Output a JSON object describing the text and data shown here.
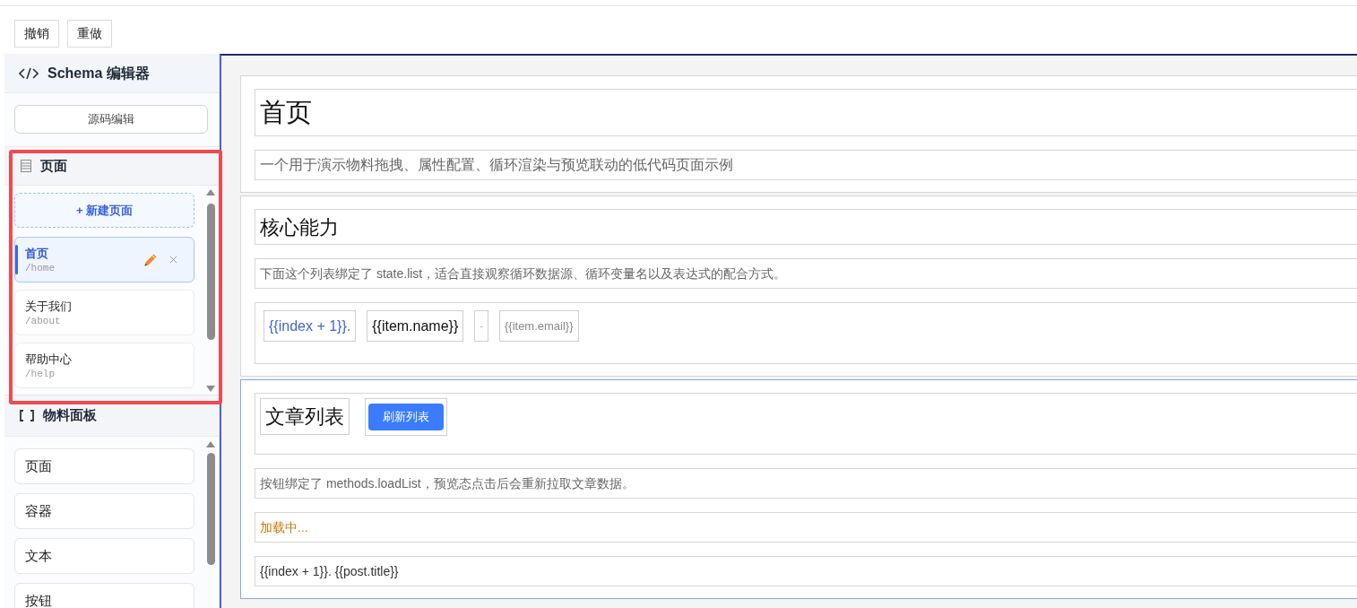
{
  "toolbar": {
    "buttons": [
      {
        "label": "撤销"
      },
      {
        "label": "重做"
      }
    ]
  },
  "sidebar": {
    "header": {
      "title": "Schema 编辑器"
    },
    "source_button": {
      "label": "源码编辑"
    },
    "pages_panel": {
      "title": "页面",
      "highlighted": true,
      "new_page_button": {
        "label": "+ 新建页面"
      },
      "pages": [
        {
          "name": "首页",
          "path": "/home",
          "selected": true
        },
        {
          "name": "关于我们",
          "path": "/about",
          "selected": false
        },
        {
          "name": "帮助中心",
          "path": "/help",
          "selected": false
        }
      ]
    },
    "materials_panel": {
      "title": "物料面板",
      "items": [
        {
          "label": "页面"
        },
        {
          "label": "容器"
        },
        {
          "label": "文本"
        },
        {
          "label": "按钮"
        }
      ]
    }
  },
  "canvas": {
    "sections": [
      {
        "selected": false,
        "items": [
          {
            "kind": "title",
            "text": "首页"
          },
          {
            "kind": "subtitle",
            "text": "一个用于演示物料拖拽、属性配置、循环渲染与预览联动的低代码页面示例"
          }
        ]
      },
      {
        "selected": false,
        "items": [
          {
            "kind": "heading",
            "text": "核心能力"
          },
          {
            "kind": "paragraph",
            "text": "下面这个列表绑定了 state.list，适合直接观察循环数据源、循环变量名以及表达式的配合方式。"
          },
          {
            "kind": "loop",
            "chips": [
              {
                "kind": "accent",
                "text": "{{index + 1}}."
              },
              {
                "kind": "strong",
                "text": "{{item.name}}"
              },
              {
                "kind": "faint",
                "text": "-"
              },
              {
                "kind": "muted",
                "text": "{{item.email}}"
              }
            ]
          }
        ]
      },
      {
        "selected": true,
        "items": [
          {
            "kind": "row",
            "children": [
              {
                "kind": "heading_box",
                "text": "文章列表"
              },
              {
                "kind": "button",
                "label": "刷新列表"
              }
            ]
          },
          {
            "kind": "paragraph",
            "text": "按钮绑定了 methods.loadList，预览态点击后会重新拉取文章数据。"
          },
          {
            "kind": "status",
            "text": "加载中..."
          },
          {
            "kind": "template",
            "text": "{{index + 1}}. {{post.title}}"
          }
        ]
      }
    ]
  }
}
